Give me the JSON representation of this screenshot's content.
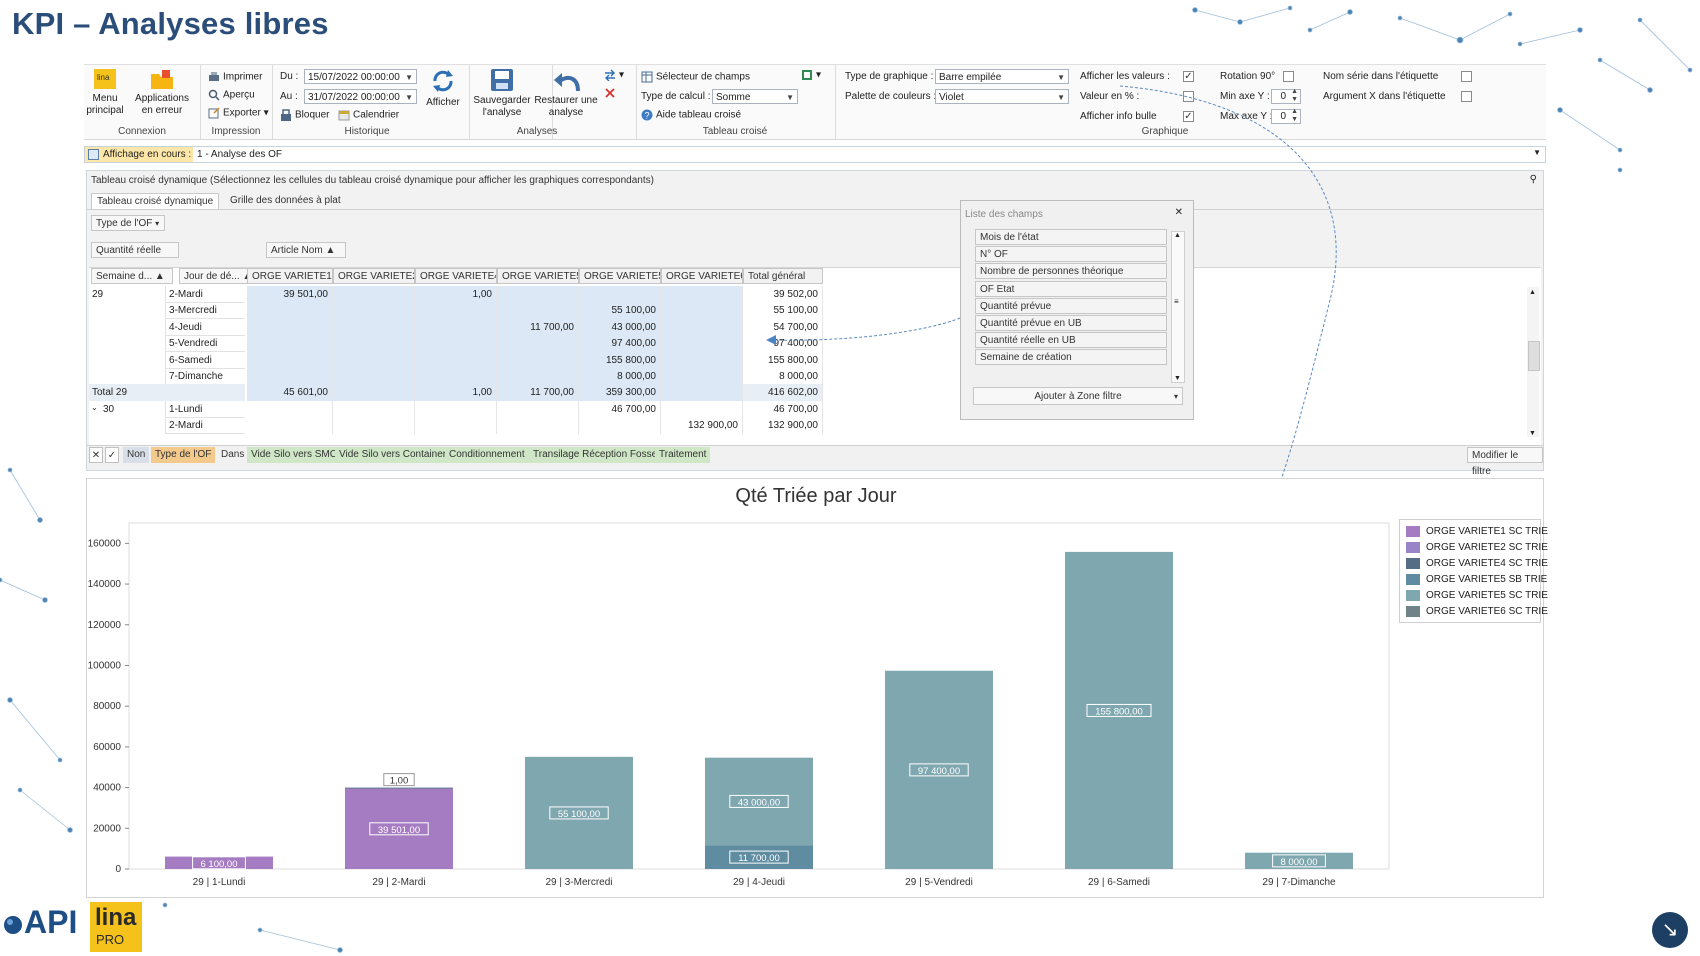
{
  "page": {
    "title": "KPI – Analyses libres"
  },
  "ribbon": {
    "connexion": {
      "menu_label": "Menu principal",
      "apps_label": "Applications en erreur",
      "group": "Connexion"
    },
    "impression": {
      "print": "Imprimer",
      "preview": "Aperçu",
      "export": "Exporter",
      "group": "Impression"
    },
    "historique": {
      "from_label": "Du :",
      "from_value": "15/07/2022 00:00:00",
      "to_label": "Au :",
      "to_value": "31/07/2022 00:00:00",
      "block": "Bloquer",
      "calendar": "Calendrier",
      "show": "Afficher",
      "group": "Historique"
    },
    "analyses": {
      "save": "Sauvegarder l'analyse",
      "restore": "Restaurer une analyse",
      "group": "Analyses"
    },
    "tableau": {
      "field_selector": "Sélecteur de champs",
      "calc_label": "Type de calcul :",
      "calc_value": "Somme",
      "help": "Aide tableau croisé",
      "group": "Tableau croisé"
    },
    "graphique": {
      "type_label": "Type de graphique :",
      "type_value": "Barre empilée",
      "palette_label": "Palette de couleurs :",
      "palette_value": "Violet",
      "show_values": "Afficher les valeurs :",
      "value_pct": "Valeur en % :",
      "show_bubble": "Afficher info bulle",
      "rotation": "Rotation 90°",
      "min_y": "Min axe Y :",
      "max_y": "Max axe Y :",
      "min_y_value": "0",
      "max_y_value": "0",
      "series_name": "Nom série dans l'étiquette",
      "arg_x": "Argument X dans l'étiquette",
      "group": "Graphique"
    }
  },
  "display": {
    "label": "Affichage en cours :",
    "value": "1 - Analyse des OF"
  },
  "pivot": {
    "header": "Tableau croisé dynamique (Sélectionnez les cellules du tableau croisé dynamique pour afficher les graphiques correspondants)",
    "tabs": [
      "Tableau croisé dynamique",
      "Grille des données à plat"
    ],
    "filter_field": "Type de l'OF",
    "data_field": "Quantité réelle",
    "column_field": "Article Nom",
    "row_fields": [
      "Semaine d...",
      "Jour de dé..."
    ],
    "columns": [
      "ORGE VARIETE1 ...",
      "ORGE VARIETE2 ...",
      "ORGE VARIETE4 ...",
      "ORGE VARIETE5 ...",
      "ORGE VARIETE5 ...",
      "ORGE VARIETE6 ...",
      "Total général"
    ],
    "rows": [
      {
        "week": "29",
        "day": "2-Mardi",
        "vals": [
          "39 501,00",
          "",
          "1,00",
          "",
          "",
          "",
          "39 502,00"
        ]
      },
      {
        "week": "",
        "day": "3-Mercredi",
        "vals": [
          "",
          "",
          "",
          "",
          "55 100,00",
          "",
          "55 100,00"
        ]
      },
      {
        "week": "",
        "day": "4-Jeudi",
        "vals": [
          "",
          "",
          "",
          "11 700,00",
          "43 000,00",
          "",
          "54 700,00"
        ]
      },
      {
        "week": "",
        "day": "5-Vendredi",
        "vals": [
          "",
          "",
          "",
          "",
          "97 400,00",
          "",
          "97 400,00"
        ]
      },
      {
        "week": "",
        "day": "6-Samedi",
        "vals": [
          "",
          "",
          "",
          "",
          "155 800,00",
          "",
          "155 800,00"
        ]
      },
      {
        "week": "",
        "day": "7-Dimanche",
        "vals": [
          "",
          "",
          "",
          "",
          "8 000,00",
          "",
          "8 000,00"
        ]
      }
    ],
    "total_row": {
      "label": "Total 29",
      "vals": [
        "45 601,00",
        "",
        "1,00",
        "11 700,00",
        "359 300,00",
        "",
        "416 602,00"
      ]
    },
    "week30_rows": [
      {
        "week": "30",
        "day": "1-Lundi",
        "vals": [
          "",
          "",
          "",
          "",
          "46 700,00",
          "",
          "46 700,00"
        ]
      },
      {
        "week": "",
        "day": "2-Mardi",
        "vals": [
          "",
          "",
          "",
          "",
          "",
          "132 900,00",
          "132 900,00"
        ]
      }
    ],
    "filter_bar": {
      "not": "Non",
      "field": "Type de l'OF",
      "in": "Dans",
      "values": [
        "Vide Silo vers SMC",
        "Vide Silo vers Container",
        "Conditionnement",
        "Transilage Réception Fosse",
        "Traitement"
      ],
      "edit": "Modifier le filtre"
    }
  },
  "field_list": {
    "title": "Liste des champs",
    "items": [
      "Mois de l'état",
      "N° OF",
      "Nombre de personnes théorique",
      "OF Etat",
      "Quantité prévue",
      "Quantité prévue en UB",
      "Quantité réelle en UB",
      "Semaine de création"
    ],
    "add_zone": "Ajouter à Zone filtre"
  },
  "colors": {
    "violet": "#a57cc2",
    "violet2": "#9a84c8",
    "slate": "#566d86",
    "teal_dark": "#5f8ca0",
    "teal": "#7fa7b0",
    "gray_teal": "#6f8389",
    "accent": "#2a4d79"
  },
  "chart_data": {
    "type": "bar",
    "stacked": true,
    "title": "Qté Triée par Jour",
    "categories": [
      "29 | 1-Lundi",
      "29 | 2-Mardi",
      "29 | 3-Mercredi",
      "29 | 4-Jeudi",
      "29 | 5-Vendredi",
      "29 | 6-Samedi",
      "29 | 7-Dimanche"
    ],
    "ylim": [
      0,
      170000
    ],
    "yticks": [
      0,
      20000,
      40000,
      60000,
      80000,
      100000,
      120000,
      140000,
      160000
    ],
    "legend_position": "top-right",
    "series": [
      {
        "name": "ORGE VARIETE1 SC TRIE",
        "color": "#a57cc2",
        "values": [
          6100,
          39501,
          0,
          0,
          0,
          0,
          0
        ],
        "labels": [
          "6 100,00",
          "39 501,00",
          "",
          "",
          "",
          "",
          ""
        ]
      },
      {
        "name": "ORGE VARIETE2 SC TRIE",
        "color": "#9a84c8",
        "values": [
          0,
          0,
          0,
          0,
          0,
          0,
          0
        ],
        "labels": [
          "",
          "",
          "",
          "",
          "",
          "",
          ""
        ]
      },
      {
        "name": "ORGE VARIETE4 SC TRIE",
        "color": "#566d86",
        "values": [
          0,
          1,
          0,
          0,
          0,
          0,
          0
        ],
        "labels": [
          "",
          "1,00",
          "",
          "",
          "",
          "",
          ""
        ]
      },
      {
        "name": "ORGE VARIETE5 SB TRIE",
        "color": "#5f8ca0",
        "values": [
          0,
          0,
          0,
          11700,
          0,
          0,
          0
        ],
        "labels": [
          "",
          "",
          "",
          "11 700,00",
          "",
          "",
          ""
        ]
      },
      {
        "name": "ORGE VARIETE5 SC TRIE",
        "color": "#7fa7b0",
        "values": [
          0,
          0,
          55100,
          43000,
          97400,
          155800,
          8000
        ],
        "labels": [
          "",
          "",
          "55 100,00",
          "43 000,00",
          "97 400,00",
          "155 800,00",
          "8 000,00"
        ]
      },
      {
        "name": "ORGE VARIETE6 SC TRIE",
        "color": "#6f8389",
        "values": [
          0,
          0,
          0,
          0,
          0,
          0,
          0
        ],
        "labels": [
          "",
          "",
          "",
          "",
          "",
          "",
          ""
        ]
      }
    ]
  },
  "logos": {
    "api": "API",
    "lina": "lina",
    "pro": "PRO"
  }
}
